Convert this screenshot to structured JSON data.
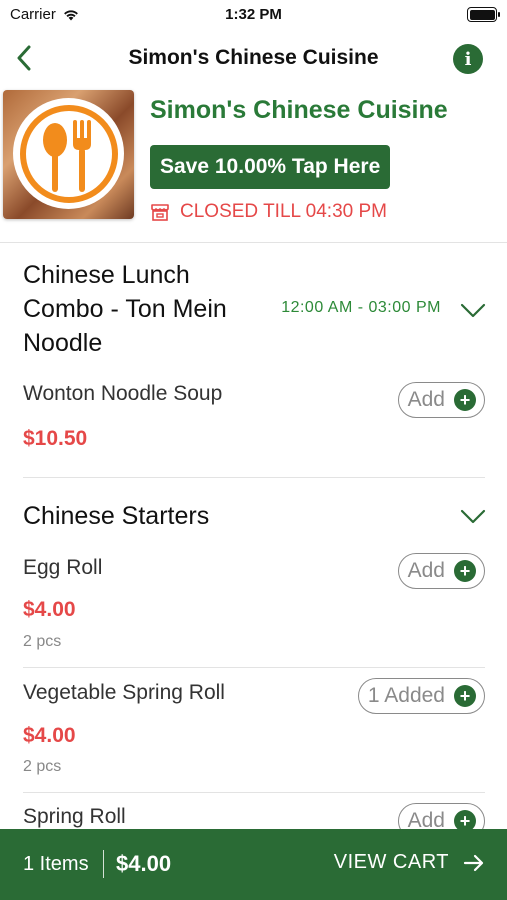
{
  "status_bar": {
    "carrier": "Carrier",
    "time": "1:32 PM"
  },
  "nav": {
    "title": "Simon's Chinese Cuisine",
    "back_icon": "chevron-left-icon",
    "info_icon": "info-icon"
  },
  "restaurant": {
    "name": "Simon's Chinese Cuisine",
    "promo_label": "Save 10.00% Tap Here",
    "status_text": "CLOSED TILL 04:30 PM",
    "status_icon": "store-icon",
    "logo_icon": "spoon-fork-icon"
  },
  "sections": [
    {
      "title_lines": [
        "Chinese Lunch",
        "Combo - Ton Mein",
        "Noodle"
      ],
      "time": "12:00 AM - 03:00 PM",
      "items": [
        {
          "name": "Wonton Noodle Soup",
          "price": "$10.50",
          "desc": "",
          "button_label": "Add"
        }
      ]
    },
    {
      "title_lines": [
        "Chinese Starters"
      ],
      "time": "",
      "items": [
        {
          "name": "Egg Roll",
          "price": "$4.00",
          "desc": "2 pcs",
          "button_label": "Add"
        },
        {
          "name": "Vegetable Spring Roll",
          "price": "$4.00",
          "desc": "2 pcs",
          "button_label": "1 Added"
        },
        {
          "name": "Spring Roll",
          "price": "",
          "desc": "",
          "button_label": "Add"
        }
      ]
    }
  ],
  "cart": {
    "count_label": "1 Items",
    "total": "$4.00",
    "view_label": "VIEW CART",
    "arrow_icon": "arrow-right-icon"
  },
  "colors": {
    "brand_green": "#2a6b35",
    "title_green": "#2a7a38",
    "price_red": "#e54848",
    "closed_red": "#e54848"
  }
}
